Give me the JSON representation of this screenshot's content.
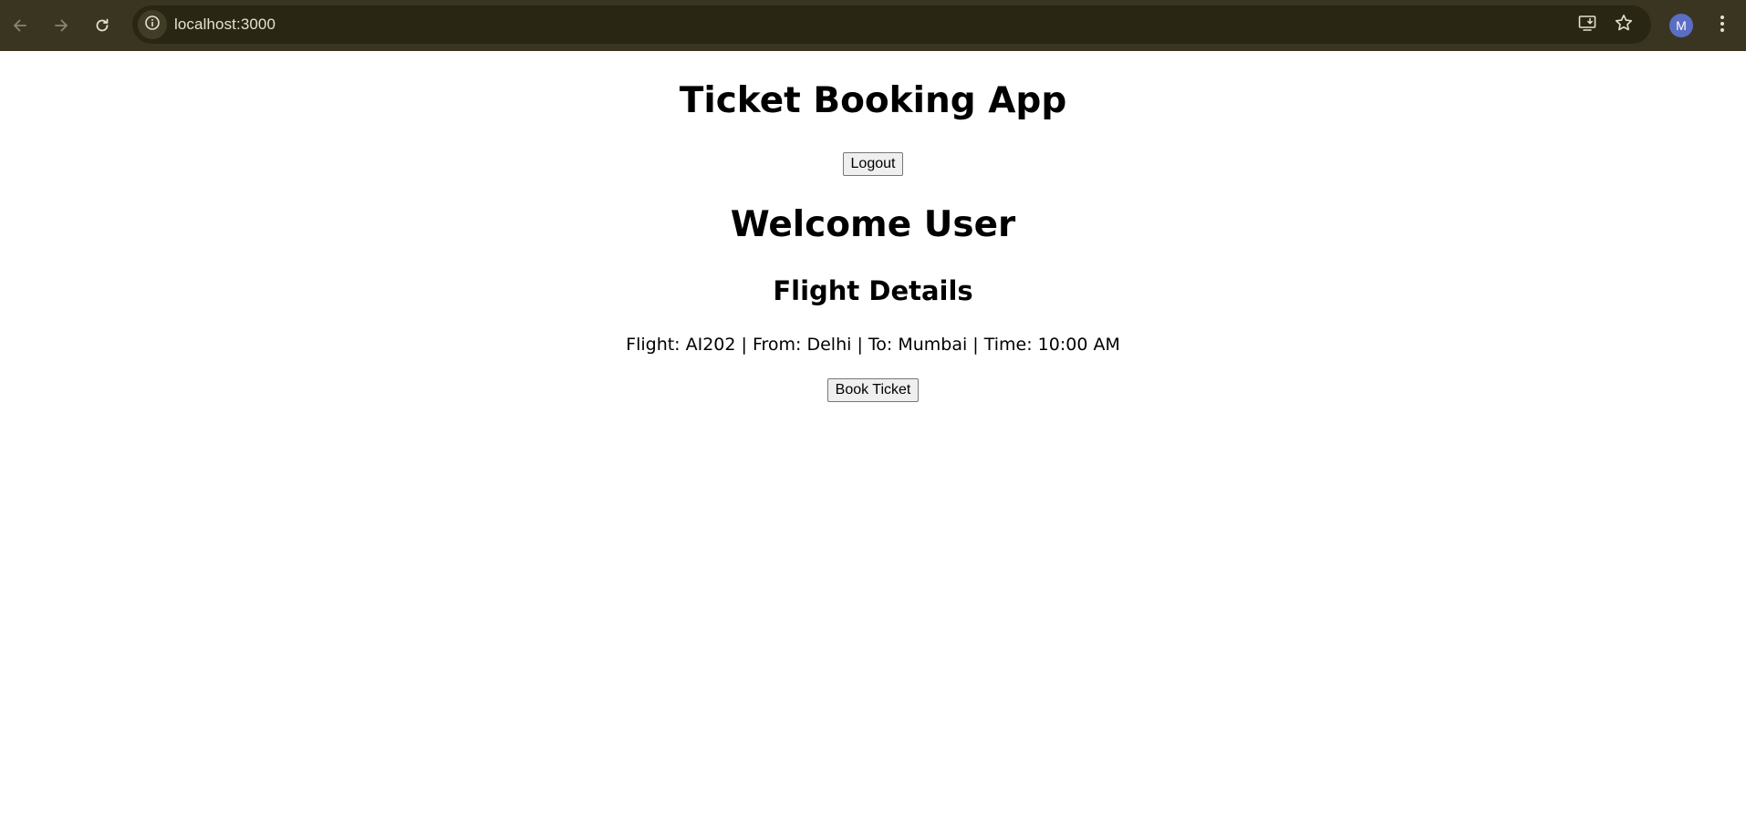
{
  "browser": {
    "url": "localhost:3000",
    "profile_initial": "M",
    "icons": {
      "back": "back-arrow-icon",
      "forward": "forward-arrow-icon",
      "reload": "reload-icon",
      "site_info": "info-icon",
      "install": "install-app-icon",
      "bookmark": "star-icon",
      "menu": "kebab-menu-icon"
    },
    "colors": {
      "toolbar": "#3a3520",
      "omnibox": "#2a2614",
      "avatar": "#5b6ec4"
    }
  },
  "app": {
    "title": "Ticket Booking App",
    "logout_label": "Logout",
    "welcome": "Welcome User",
    "section_title": "Flight Details",
    "flight_info": "Flight: AI202 | From: Delhi | To: Mumbai | Time: 10:00 AM",
    "book_label": "Book Ticket"
  }
}
